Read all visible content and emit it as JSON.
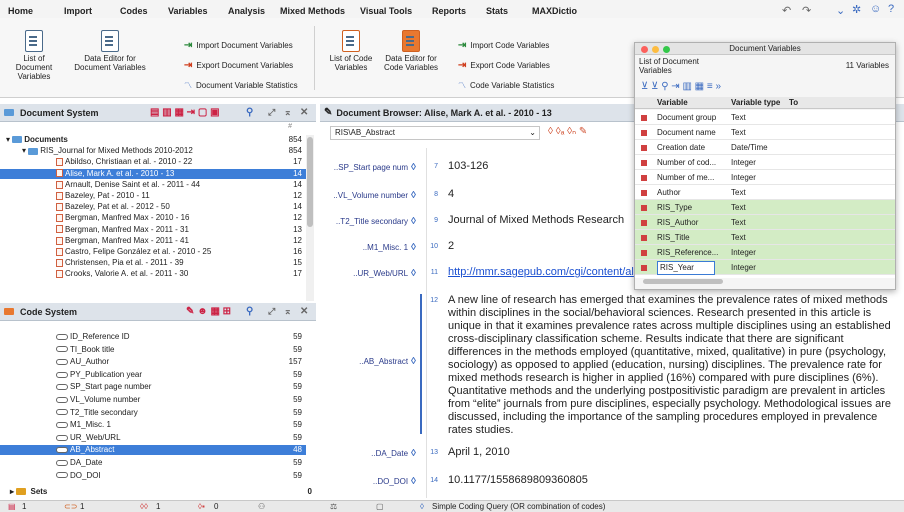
{
  "menu": {
    "items": [
      "Home",
      "Import",
      "Codes",
      "Variables",
      "Analysis",
      "Mixed Methods",
      "Visual Tools",
      "Reports",
      "Stats",
      "MAXDictio"
    ],
    "active_index": 3
  },
  "ribbon": {
    "list_doc_vars": "List of Document\nVariables",
    "data_editor_doc": "Data Editor for\nDocument Variables",
    "import_doc_vars": "Import Document Variables",
    "export_doc_vars": "Export Document Variables",
    "doc_var_stats": "Document Variable Statistics",
    "list_code_vars": "List of Code\nVariables",
    "data_editor_code": "Data Editor for\nCode Variables",
    "import_code_vars": "Import Code Variables",
    "export_code_vars": "Export Code Variables",
    "code_var_stats": "Code Variable Statistics"
  },
  "document_system": {
    "title": "Document System",
    "col_hash": "#",
    "rows": [
      {
        "label": "Documents",
        "count": "854",
        "level": 0,
        "type": "root"
      },
      {
        "label": "RIS_Journal for Mixed Methods 2010-2012",
        "count": "854",
        "level": 1,
        "type": "folder"
      },
      {
        "label": "Abildso, Christiaan et al. - 2010 - 22",
        "count": "17",
        "level": 2,
        "type": "doc"
      },
      {
        "label": "Alise, Mark A. et al. - 2010 - 13",
        "count": "14",
        "level": 2,
        "type": "doc",
        "selected": true
      },
      {
        "label": "Arnault, Denise Saint et al. - 2011 - 44",
        "count": "14",
        "level": 2,
        "type": "doc"
      },
      {
        "label": "Bazeley, Pat - 2010 - 11",
        "count": "12",
        "level": 2,
        "type": "doc"
      },
      {
        "label": "Bazeley, Pat et al. - 2012 - 50",
        "count": "14",
        "level": 2,
        "type": "doc"
      },
      {
        "label": "Bergman, Manfred Max - 2010 - 16",
        "count": "12",
        "level": 2,
        "type": "doc"
      },
      {
        "label": "Bergman, Manfred Max - 2011 - 31",
        "count": "13",
        "level": 2,
        "type": "doc"
      },
      {
        "label": "Bergman, Manfred Max - 2011 - 41",
        "count": "12",
        "level": 2,
        "type": "doc"
      },
      {
        "label": "Castro, Felipe González et al. - 2010 - 25",
        "count": "16",
        "level": 2,
        "type": "doc"
      },
      {
        "label": "Christensen, Pia et al. - 2011 - 39",
        "count": "15",
        "level": 2,
        "type": "doc"
      },
      {
        "label": "Crooks, Valorie A. et al. - 2011 - 30",
        "count": "17",
        "level": 2,
        "type": "doc"
      }
    ]
  },
  "code_system": {
    "title": "Code System",
    "rows": [
      {
        "label": "ID_Reference ID",
        "count": "59"
      },
      {
        "label": "TI_Book title",
        "count": "59"
      },
      {
        "label": "AU_Author",
        "count": "157"
      },
      {
        "label": "PY_Publication year",
        "count": "59"
      },
      {
        "label": "SP_Start page number",
        "count": "59"
      },
      {
        "label": "VL_Volume number",
        "count": "59"
      },
      {
        "label": "T2_Title secondary",
        "count": "59"
      },
      {
        "label": "M1_Misc. 1",
        "count": "59"
      },
      {
        "label": "UR_Web/URL",
        "count": "59"
      },
      {
        "label": "AB_Abstract",
        "count": "48",
        "selected": true
      },
      {
        "label": "DA_Date",
        "count": "59"
      },
      {
        "label": "DO_DOI",
        "count": "59"
      }
    ],
    "sets_label": "Sets",
    "sets_count": "0"
  },
  "browser": {
    "title": "Document Browser: Alise, Mark A. et al. - 2010 - 13",
    "code_field": "RIS\\AB_Abstract",
    "segments": [
      {
        "code": "..SP_Start page num",
        "num": "7",
        "text": "103-126"
      },
      {
        "code": "..VL_Volume number",
        "num": "8",
        "text": "4"
      },
      {
        "code": "..T2_Title secondary",
        "num": "9",
        "text": "Journal of Mixed Methods Research"
      },
      {
        "code": "..M1_Misc. 1",
        "num": "10",
        "text": "2"
      },
      {
        "code": "..UR_Web/URL",
        "num": "11",
        "text": "http://mmr.sagepub.com/cgi/content/al"
      },
      {
        "code": "..AB_Abstract",
        "num": "12",
        "text": "A new line of research has emerged that examines the prevalence rates of mixed methods within disciplines in the social/behavioral sciences. Research presented in this article is unique in that it examines prevalence rates across multiple disciplines using an established cross-disciplinary classification scheme. Results indicate that there are significant differences in the methods employed (quantitative, mixed, qualitative) in pure (psychology, sociology) as opposed to applied (education, nursing) disciplines. The prevalence rate for mixed methods research is higher in applied (16%) compared with pure disciplines (6%). Quantitative methods and the underlying postpositivistic paradigm are prevalent in articles from “elite” journals from pure disciplines, especially psychology. Methodological issues are discussed, including the importance of the sampling procedures employed in prevalence rates studies."
      },
      {
        "code": "..DA_Date",
        "num": "13",
        "text": "April 1, 2010"
      },
      {
        "code": "..DO_DOI",
        "num": "14",
        "text": "10.1177/1558689809360805"
      }
    ]
  },
  "doc_vars_window": {
    "title": "Document Variables",
    "subtitle": "List of Document\nVariables",
    "count_label": "11 Variables",
    "col_variable": "Variable",
    "col_type": "Variable type",
    "col_to": "To",
    "rows": [
      {
        "name": "Document group",
        "type": "Text",
        "green": false
      },
      {
        "name": "Document name",
        "type": "Text",
        "green": false
      },
      {
        "name": "Creation date",
        "type": "Date/Time",
        "green": false
      },
      {
        "name": "Number of cod...",
        "type": "Integer",
        "green": false
      },
      {
        "name": "Number of me...",
        "type": "Integer",
        "green": false
      },
      {
        "name": "Author",
        "type": "Text",
        "green": false
      },
      {
        "name": "RIS_Type",
        "type": "Text",
        "green": true
      },
      {
        "name": "RIS_Author",
        "type": "Text",
        "green": true
      },
      {
        "name": "RIS_Title",
        "type": "Text",
        "green": true
      },
      {
        "name": "RIS_Reference...",
        "type": "Integer",
        "green": true
      },
      {
        "name": "RIS_Year",
        "type": "Integer",
        "green": true
      }
    ]
  },
  "status": {
    "docs": "1",
    "codes": "1",
    "segments": "1",
    "memos": "0",
    "query": "Simple Coding Query (OR combination of codes)"
  },
  "colors": {
    "accent": "#3d7ed8",
    "green_row": "#d3ecc5",
    "link": "#1a4fd0"
  }
}
